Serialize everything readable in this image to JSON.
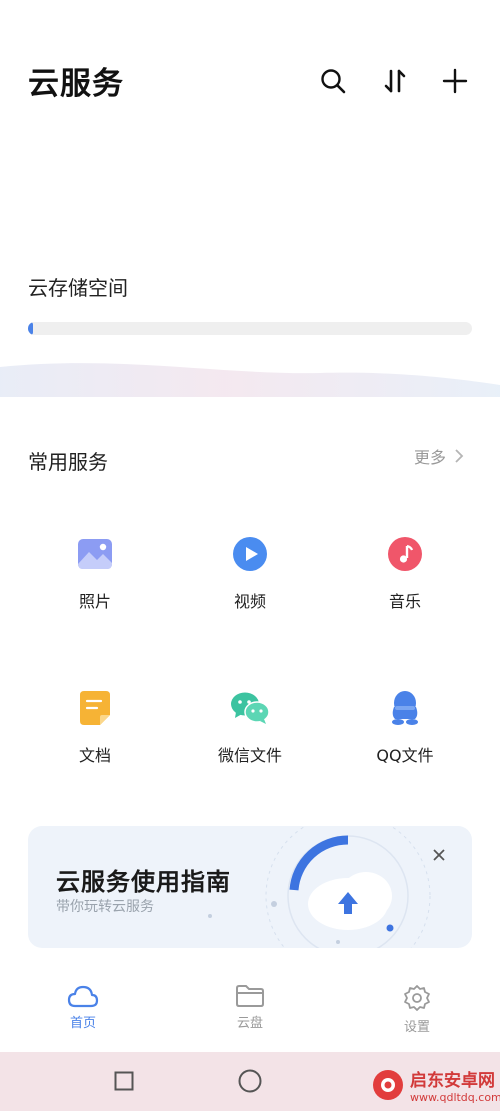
{
  "header": {
    "title": "云服务",
    "icons": [
      "search-icon",
      "sort-icon",
      "add-icon"
    ]
  },
  "storage": {
    "label": "云存储空间",
    "used_fraction": 0.01,
    "accent": "#4a82e8"
  },
  "services": {
    "title": "常用服务",
    "more": "更多",
    "items": [
      {
        "label": "照片",
        "icon": "photo-icon",
        "color": "#7b8ff0"
      },
      {
        "label": "视频",
        "icon": "video-icon",
        "color": "#4a8cf0"
      },
      {
        "label": "音乐",
        "icon": "music-icon",
        "color": "#f0566a"
      },
      {
        "label": "文档",
        "icon": "document-icon",
        "color": "#f6b335"
      },
      {
        "label": "微信文件",
        "icon": "wechat-icon",
        "color": "#3cc3a0"
      },
      {
        "label": "QQ文件",
        "icon": "qq-icon",
        "color": "#4a82e8"
      }
    ]
  },
  "guide": {
    "title": "云服务使用指南",
    "subtitle": "带你玩转云服务"
  },
  "nav": {
    "items": [
      {
        "label": "首页",
        "icon": "cloud-icon",
        "active": true
      },
      {
        "label": "云盘",
        "icon": "folder-icon",
        "active": false
      },
      {
        "label": "设置",
        "icon": "settings-icon",
        "active": false
      }
    ],
    "active_color": "#4a82e8",
    "inactive_color": "#9a9a9a"
  },
  "watermark": {
    "name": "启东安卓网",
    "url": "www.qdltdq.com"
  }
}
